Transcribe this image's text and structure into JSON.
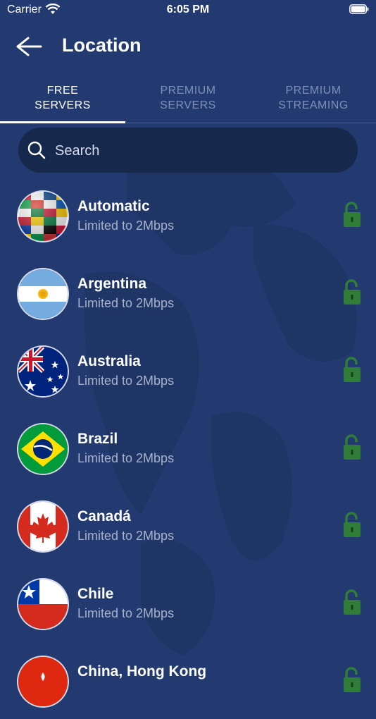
{
  "status_bar": {
    "carrier": "Carrier",
    "time": "6:05 PM"
  },
  "header": {
    "title": "Location"
  },
  "tabs": [
    {
      "label_line1": "FREE",
      "label_line2": "SERVERS",
      "active": true
    },
    {
      "label_line1": "PREMIUM",
      "label_line2": "SERVERS",
      "active": false
    },
    {
      "label_line1": "PREMIUM",
      "label_line2": "STREAMING",
      "active": false
    }
  ],
  "search": {
    "placeholder": "Search"
  },
  "servers": [
    {
      "name": "Automatic",
      "detail": "Limited to 2Mbps",
      "flag": "world-flags-icon"
    },
    {
      "name": "Argentina",
      "detail": "Limited to 2Mbps",
      "flag": "argentina-flag-icon"
    },
    {
      "name": "Australia",
      "detail": "Limited to 2Mbps",
      "flag": "australia-flag-icon"
    },
    {
      "name": "Brazil",
      "detail": "Limited to 2Mbps",
      "flag": "brazil-flag-icon"
    },
    {
      "name": "Canadá",
      "detail": "Limited to 2Mbps",
      "flag": "canada-flag-icon"
    },
    {
      "name": "Chile",
      "detail": "Limited to 2Mbps",
      "flag": "chile-flag-icon"
    },
    {
      "name": "China, Hong Kong",
      "detail": "",
      "flag": "hong-kong-flag-icon"
    }
  ],
  "colors": {
    "background": "#223a70",
    "search_bg": "#17284d",
    "lock_green": "#2f7d37",
    "inactive_tab": "#7f8fb6"
  }
}
